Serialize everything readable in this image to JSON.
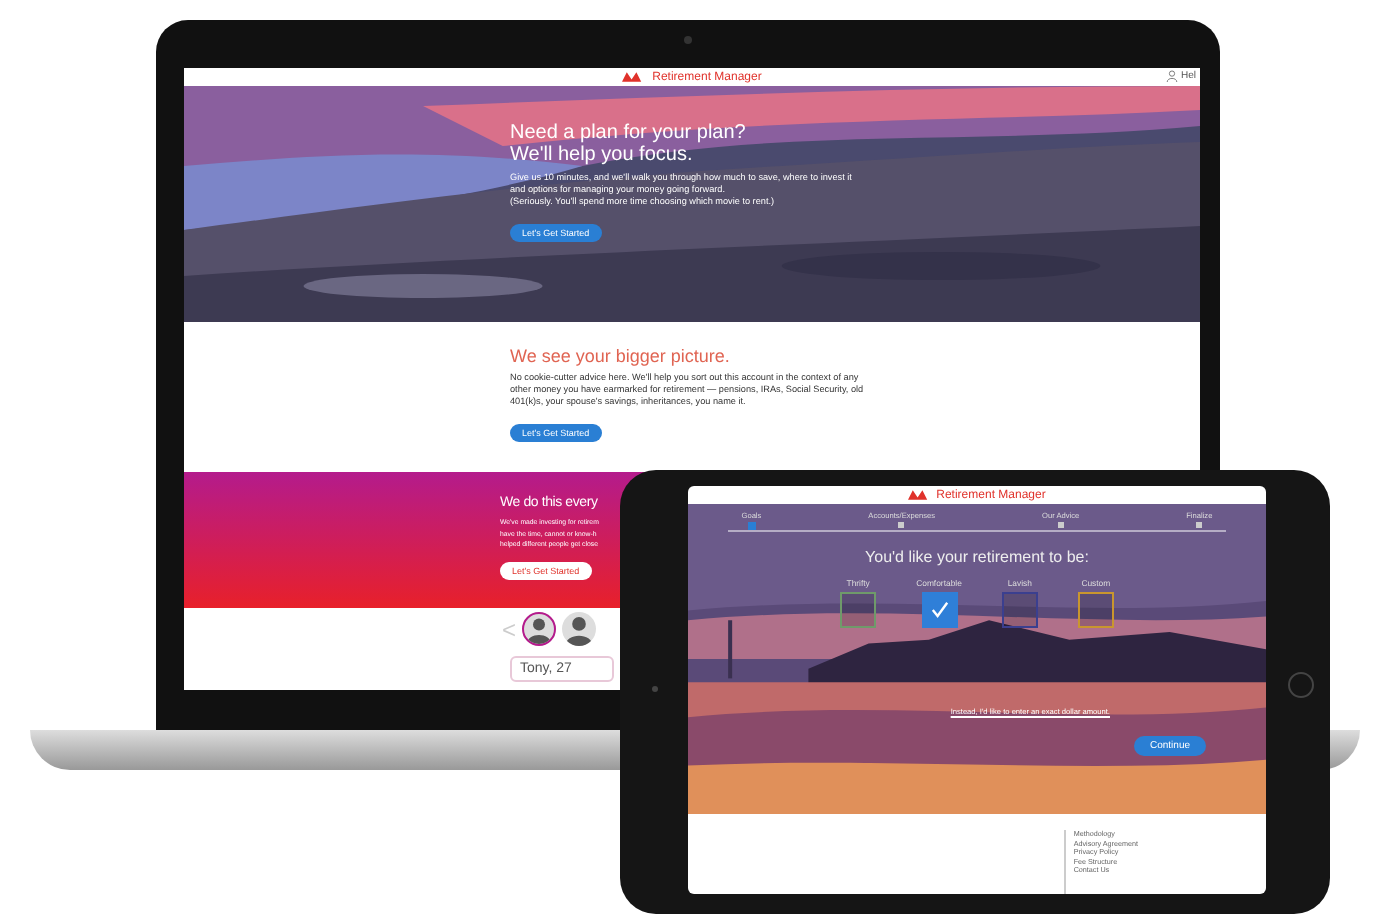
{
  "laptop": {
    "header": {
      "title": "Retirement Manager",
      "user": "Hel"
    },
    "hero": {
      "kind": "picture",
      "headline": [
        "Need a plan for your plan?",
        "We'll help you focus."
      ],
      "body": [
        "Give us 10 minutes, and we'll walk you through how much to save, where to invest it",
        "and options for managing your money going forward.",
        "(Seriously. You'll spend more time choosing which movie to rent.)"
      ],
      "button": "Let's Get Started"
    },
    "bigger_picture": {
      "heading": "We see your bigger picture.",
      "body": [
        "No cookie-cutter advice here. We'll help you sort out this account in the context of any",
        "other money you have earmarked for retirement — pensions, IRAs, Social Security, old",
        "401(k)s, your spouse's savings, inheritances, you name it."
      ],
      "button": "Let's Get Started"
    },
    "every_day": {
      "heading": "We do this every",
      "body": [
        "We've made investing for retirem",
        "have the time, cannot or know-h",
        "helped different people get close"
      ],
      "button": "Let's Get Started"
    },
    "testimonials": {
      "previous": "<",
      "people": [
        {
          "selected": true
        },
        {
          "selected": false
        }
      ],
      "name": "Tony, 27"
    }
  },
  "tablet": {
    "header": {
      "title": "Retirement Manager"
    },
    "steps": [
      {
        "label": "Goals",
        "selected": true
      },
      {
        "label": "Accounts/Expenses",
        "selected": false
      },
      {
        "label": "Our Advice",
        "selected": false
      },
      {
        "label": "Finalize",
        "selected": false
      }
    ],
    "question": "You'd like your retirement to be:",
    "options": [
      {
        "label": "Thrifty",
        "selected": false,
        "color": "#6f9a6a"
      },
      {
        "label": "Comfortable",
        "selected": true,
        "color": "#2f7fd8"
      },
      {
        "label": "Lavish",
        "selected": false,
        "color": "#3b3f8f"
      },
      {
        "label": "Custom",
        "selected": false,
        "color": "#c9962e"
      }
    ],
    "exact_amount_link": "Instead, I'd like to enter an exact dollar amount.",
    "continue_button": "Continue",
    "footer_links": [
      "Methodology",
      "Advisory Agreement",
      "Privacy Policy",
      "Fee Structure",
      "Contact Us"
    ]
  }
}
